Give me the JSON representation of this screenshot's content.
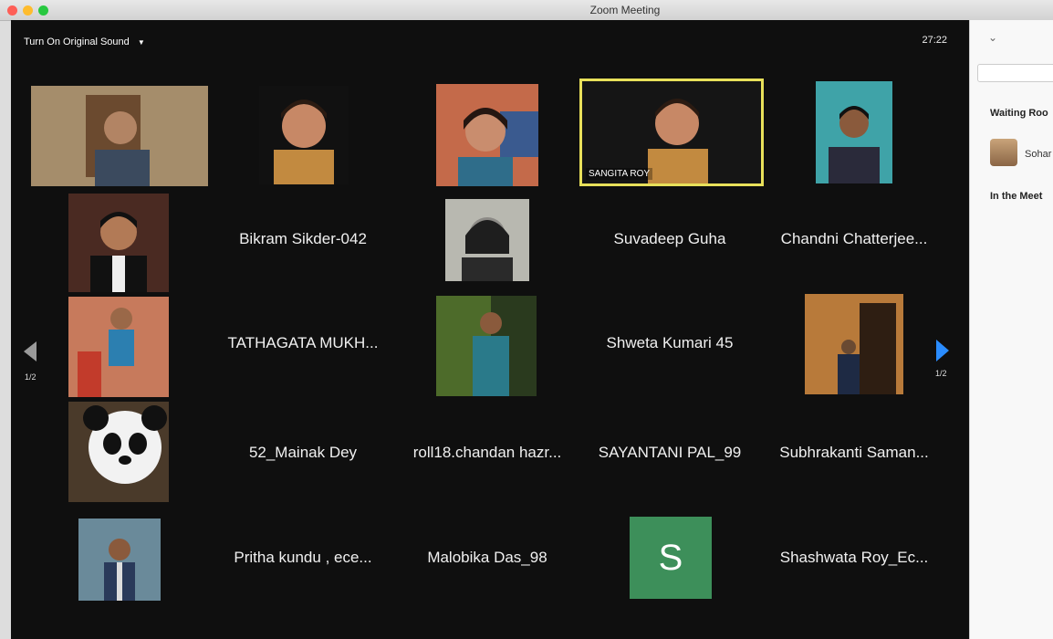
{
  "window": {
    "title": "Zoom Meeting"
  },
  "toolbar": {
    "sound_label": "Turn On Original Sound",
    "timer": "27:22"
  },
  "pagination": {
    "left": "1/2",
    "right": "1/2"
  },
  "participants_with_names": [
    "Bikram Sikder-042",
    "Suvadeep Guha",
    "Chandni Chatterjee...",
    "TATHAGATA MUKH...",
    "Shweta Kumari 45",
    "52_Mainak Dey",
    "roll18.chandan hazr...",
    "SAYANTANI PAL_99",
    "Subhrakanti Saman...",
    "Pritha kundu , ece...",
    "Malobika Das_98",
    "Shashwata Roy_Ec..."
  ],
  "active_speaker": "SANGITA ROY",
  "initial_avatar": "S",
  "sidebar": {
    "waiting_heading": "Waiting Roo",
    "waiting_person": "Sohar",
    "in_meeting_heading": "In the Meet"
  },
  "colors": {
    "highlight": "#e8e05a",
    "arrow": "#2a8cff",
    "initial_bg": "#3d8f5a"
  }
}
